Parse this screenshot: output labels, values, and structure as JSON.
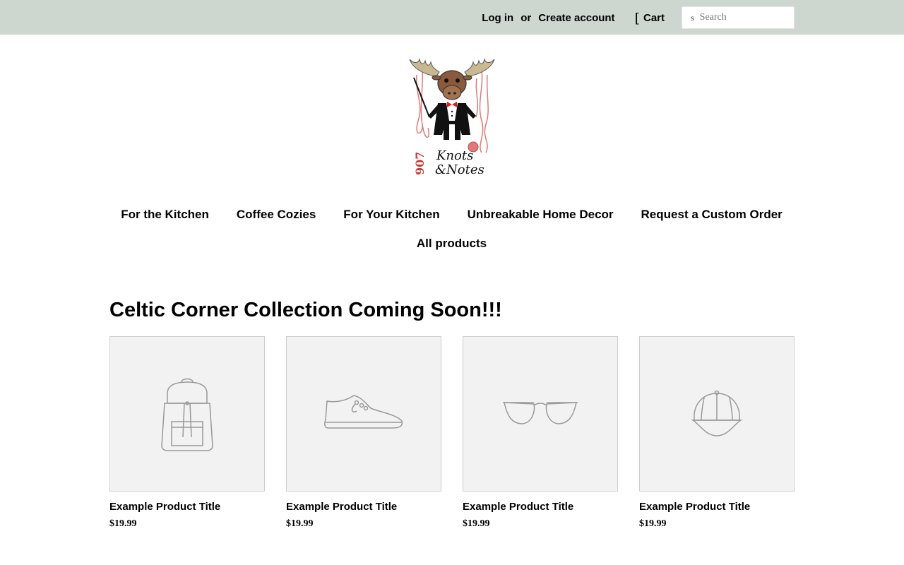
{
  "header": {
    "login_label": "Log in",
    "or_label": "or",
    "create_account_label": "Create account",
    "cart_icon": "cart-icon",
    "cart_icon_glyph": "[",
    "cart_label": "Cart",
    "search_icon": "search-icon",
    "search_icon_glyph": "s",
    "search_placeholder": "Search",
    "bg_color": "#cdd6cf"
  },
  "logo": {
    "text_number": "907",
    "text_line1": "Knots",
    "text_line2": "&Notes"
  },
  "nav": {
    "row1": [
      "For the Kitchen",
      "Coffee Cozies",
      "For Your Kitchen",
      "Unbreakable Home Decor",
      "Request a Custom Order"
    ],
    "row2": [
      "All products"
    ]
  },
  "collection": {
    "title": "Celtic Corner Collection Coming Soon!!!",
    "products": [
      {
        "title": "Example Product Title",
        "price": "$19.99",
        "icon": "backpack-icon"
      },
      {
        "title": "Example Product Title",
        "price": "$19.99",
        "icon": "sneaker-icon"
      },
      {
        "title": "Example Product Title",
        "price": "$19.99",
        "icon": "glasses-icon"
      },
      {
        "title": "Example Product Title",
        "price": "$19.99",
        "icon": "cap-icon"
      }
    ]
  }
}
